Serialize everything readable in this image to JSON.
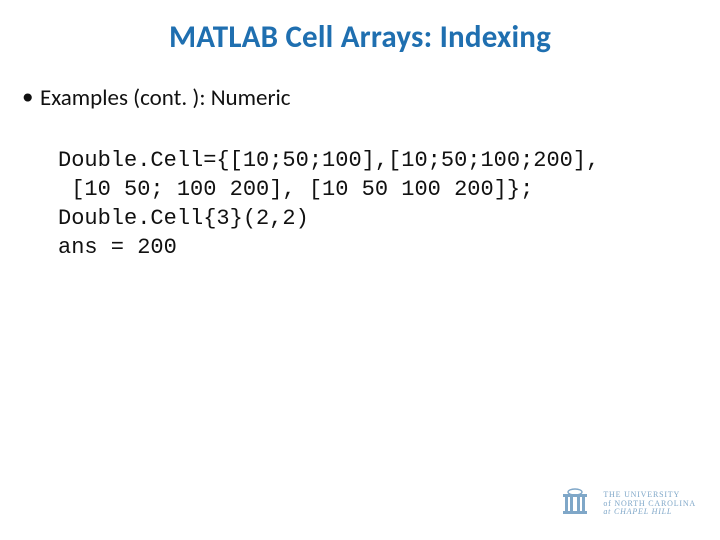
{
  "title": "MATLAB Cell Arrays: Indexing",
  "bullet": {
    "marker": "•",
    "text": "Examples (cont. ): Numeric"
  },
  "code": {
    "line1": "Double.Cell={[10;50;100],[10;50;100;200],",
    "line2": " [10 50; 100 200], [10 50 100 200]};",
    "line3": "Double.Cell{3}(2,2)",
    "line4": "ans = 200"
  },
  "footer": {
    "line1": "THE UNIVERSITY",
    "line2_prefix": "of ",
    "line2_main": "NORTH CAROLINA",
    "line3_prefix": "at ",
    "line3_main": "CHAPEL HILL"
  },
  "colors": {
    "title": "#1f6fb0",
    "body": "#111111",
    "footer": "#7fa7c8"
  }
}
